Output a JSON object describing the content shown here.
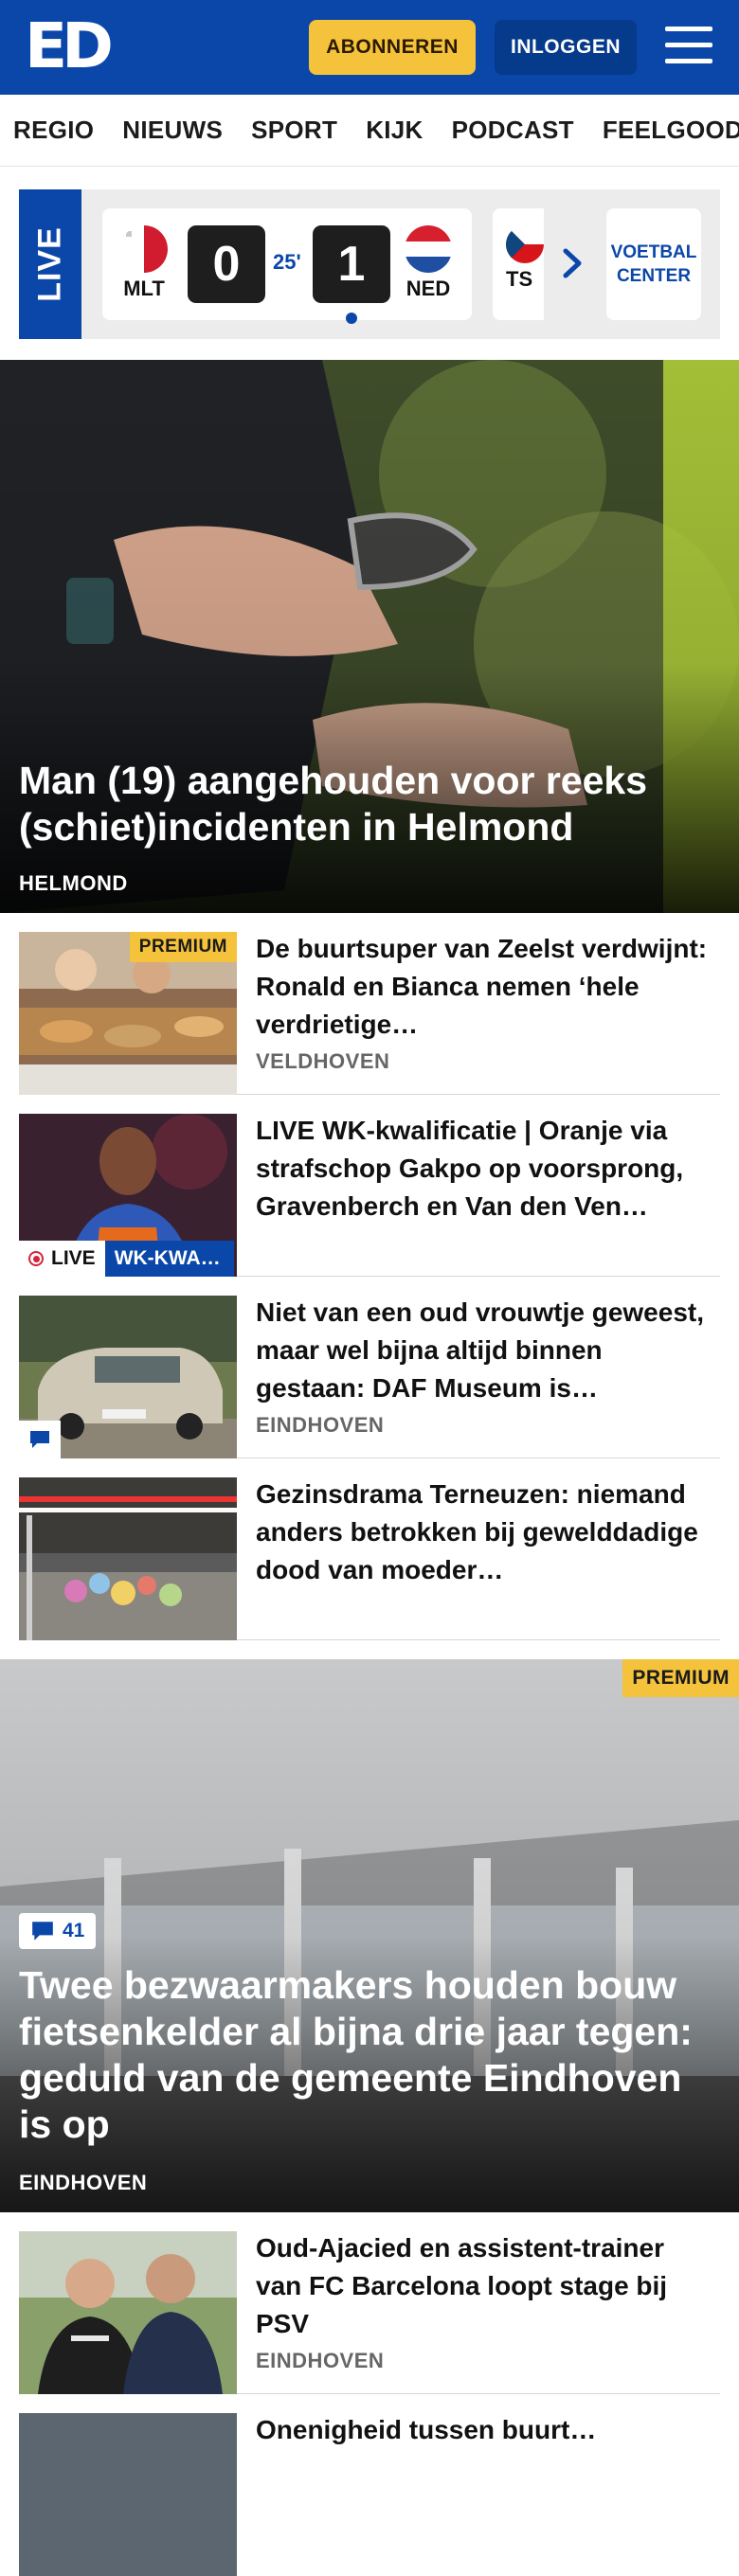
{
  "header": {
    "logo_text": "ED",
    "subscribe_label": "ABONNEREN",
    "login_label": "INLOGGEN",
    "menu_icon": "hamburger-menu-icon",
    "brand_color": "#0b47a9",
    "accent_color": "#f5c23b"
  },
  "nav": {
    "items": [
      "REGIO",
      "NIEUWS",
      "SPORT",
      "KIJK",
      "PODCAST",
      "FEELGOOD"
    ]
  },
  "live_ticker": {
    "label": "LIVE",
    "match": {
      "home_code": "MLT",
      "home_score": "0",
      "minute": "25'",
      "away_score": "1",
      "away_code": "NED"
    },
    "next_match_code": "TS",
    "next_icon": "chevron-right-icon",
    "center_label_line1": "VOETBAL",
    "center_label_line2": "CENTER"
  },
  "hero": {
    "title": "Man (19) aangehouden voor reeks (schiet)incidenten in Helmond",
    "location": "HELMOND"
  },
  "articles": [
    {
      "title": "De buurtsuper van Zeelst verdwijnt: Ronald en Bianca nemen ‘hele verdrietige…",
      "location": "VELDHOVEN",
      "badge": "PREMIUM"
    },
    {
      "title": "LIVE WK-kwalificatie | Oranje via strafschop Gakpo op voorsprong, Gravenberch en Van den Ven…",
      "live_label": "LIVE",
      "category": "WK-KWA…"
    },
    {
      "title": "Niet van een oud vrouwtje geweest, maar wel bijna altijd binnen gestaan: DAF Museum is…",
      "location": "EINDHOVEN",
      "icon": "comment-icon"
    },
    {
      "title": "Gezinsdrama Terneuzen: niemand anders betrokken bij gewelddadige dood van moeder…"
    }
  ],
  "feature": {
    "badge": "PREMIUM",
    "comment_count": "41",
    "title": "Twee bezwaarmakers houden bouw fietsenkelder al bijna drie jaar tegen: geduld van de gemeente Eindhoven is op",
    "location": "EINDHOVEN"
  },
  "bottom_article": {
    "title": "Oud-Ajacied en assistent-trainer van FC Barcelona loopt stage bij PSV",
    "location": "EINDHOVEN"
  },
  "partial_article": {
    "title": "Onenigheid tussen buurt…"
  }
}
